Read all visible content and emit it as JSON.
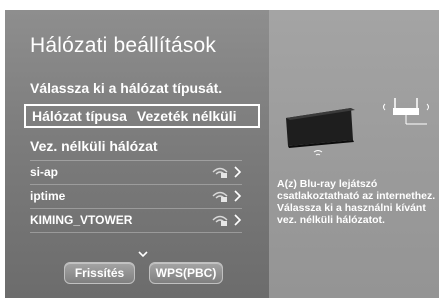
{
  "title": "Hálózati beállítások",
  "subtitle": "Válassza ki a hálózat típusát.",
  "network_type": {
    "label": "Hálózat típusa",
    "value": "Vezeték nélküli"
  },
  "wireless_section": {
    "title": "Vez. nélküli hálózat",
    "networks": [
      {
        "name": "si-ap",
        "icon": "wifi-lock-icon"
      },
      {
        "name": "iptime",
        "icon": "wifi-lock-icon"
      },
      {
        "name": "KIMING_VTOWER",
        "icon": "wifi-lock-icon"
      }
    ],
    "more_icon": "chevron-down-icon"
  },
  "buttons": {
    "refresh": "Frissítés",
    "wps": "WPS(PBC)"
  },
  "help_text": "A(z) Blu-ray lejátszó csatlakoztatható az internethez. Válassza ki a használni kívánt vez. nélküli hálózatot.",
  "colors": {
    "panel_left": "#808080",
    "panel_right": "#a0a0a0",
    "text": "#ffffff",
    "selection_border": "#ffffff"
  }
}
